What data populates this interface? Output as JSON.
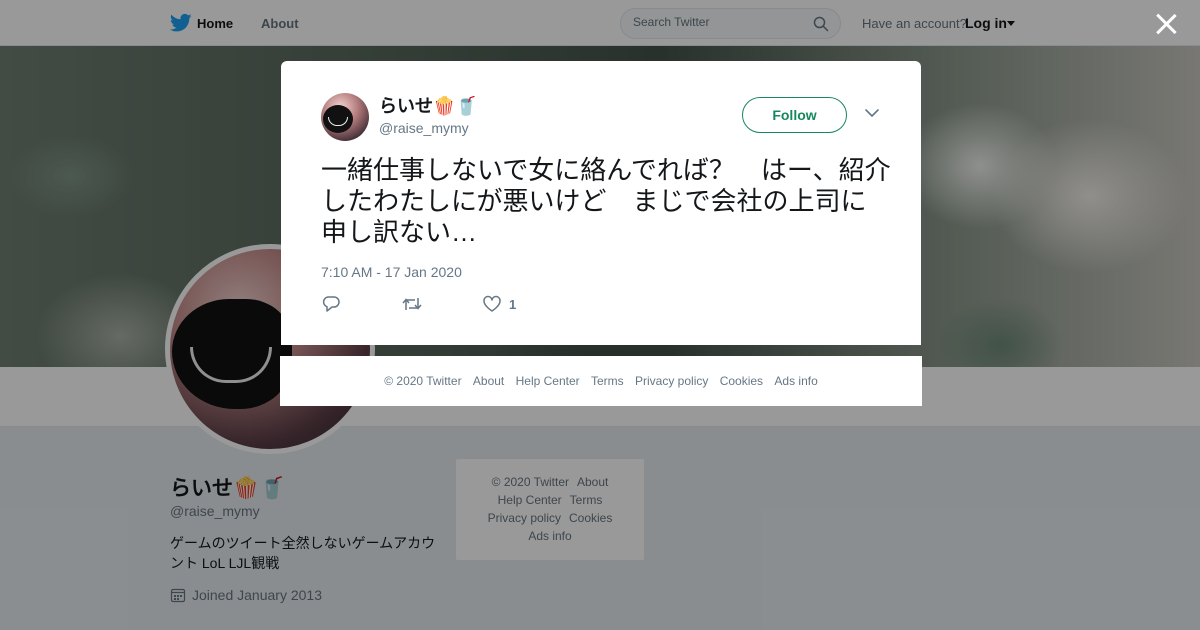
{
  "topbar": {
    "home_label": "Home",
    "about_label": "About",
    "search_placeholder": "Search Twitter",
    "have_account": "Have an account?",
    "login_label": "Log in"
  },
  "profile": {
    "name": "らいせ🍿🥤",
    "handle": "@raise_mymy",
    "bio": "ゲームのツイート全然しないゲームアカウント LoL LJL観戦",
    "joined": "Joined January 2013"
  },
  "side_footer": {
    "copyright": "© 2020 Twitter",
    "about": "About",
    "help": "Help Center",
    "terms": "Terms",
    "privacy": "Privacy policy",
    "cookies": "Cookies",
    "ads": "Ads info"
  },
  "tweet": {
    "name": "らいせ🍿🥤",
    "handle": "@raise_mymy",
    "follow_label": "Follow",
    "text": "一緒仕事しないで女に絡んでれば？　はー、紹介したわたしにが悪いけど　まじで会社の上司に申し訳ない…",
    "timestamp": "7:10 AM - 17 Jan 2020",
    "like_count": "1"
  },
  "modal_footer": {
    "copyright": "© 2020 Twitter",
    "about": "About",
    "help": "Help Center",
    "terms": "Terms",
    "privacy": "Privacy policy",
    "cookies": "Cookies",
    "ads": "Ads info"
  },
  "colors": {
    "accent": "#1da1f2",
    "follow_green": "#17885e",
    "muted": "#657786"
  }
}
